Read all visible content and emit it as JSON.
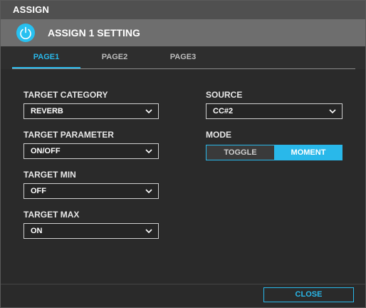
{
  "window": {
    "title": "ASSIGN"
  },
  "header": {
    "title": "ASSIGN 1 SETTING",
    "icon": "power-icon",
    "accent": "#29b8ea"
  },
  "tabs": [
    {
      "label": "PAGE1",
      "active": true
    },
    {
      "label": "PAGE2",
      "active": false
    },
    {
      "label": "PAGE3",
      "active": false
    }
  ],
  "fields": {
    "target_category": {
      "label": "TARGET CATEGORY",
      "value": "REVERB"
    },
    "target_parameter": {
      "label": "TARGET PARAMETER",
      "value": "ON/OFF"
    },
    "target_min": {
      "label": "TARGET MIN",
      "value": "OFF"
    },
    "target_max": {
      "label": "TARGET MAX",
      "value": "ON"
    },
    "source": {
      "label": "SOURCE",
      "value": "CC#2"
    }
  },
  "mode": {
    "label": "MODE",
    "options": [
      "TOGGLE",
      "MOMENT"
    ],
    "selected": "MOMENT"
  },
  "footer": {
    "close_label": "CLOSE"
  }
}
